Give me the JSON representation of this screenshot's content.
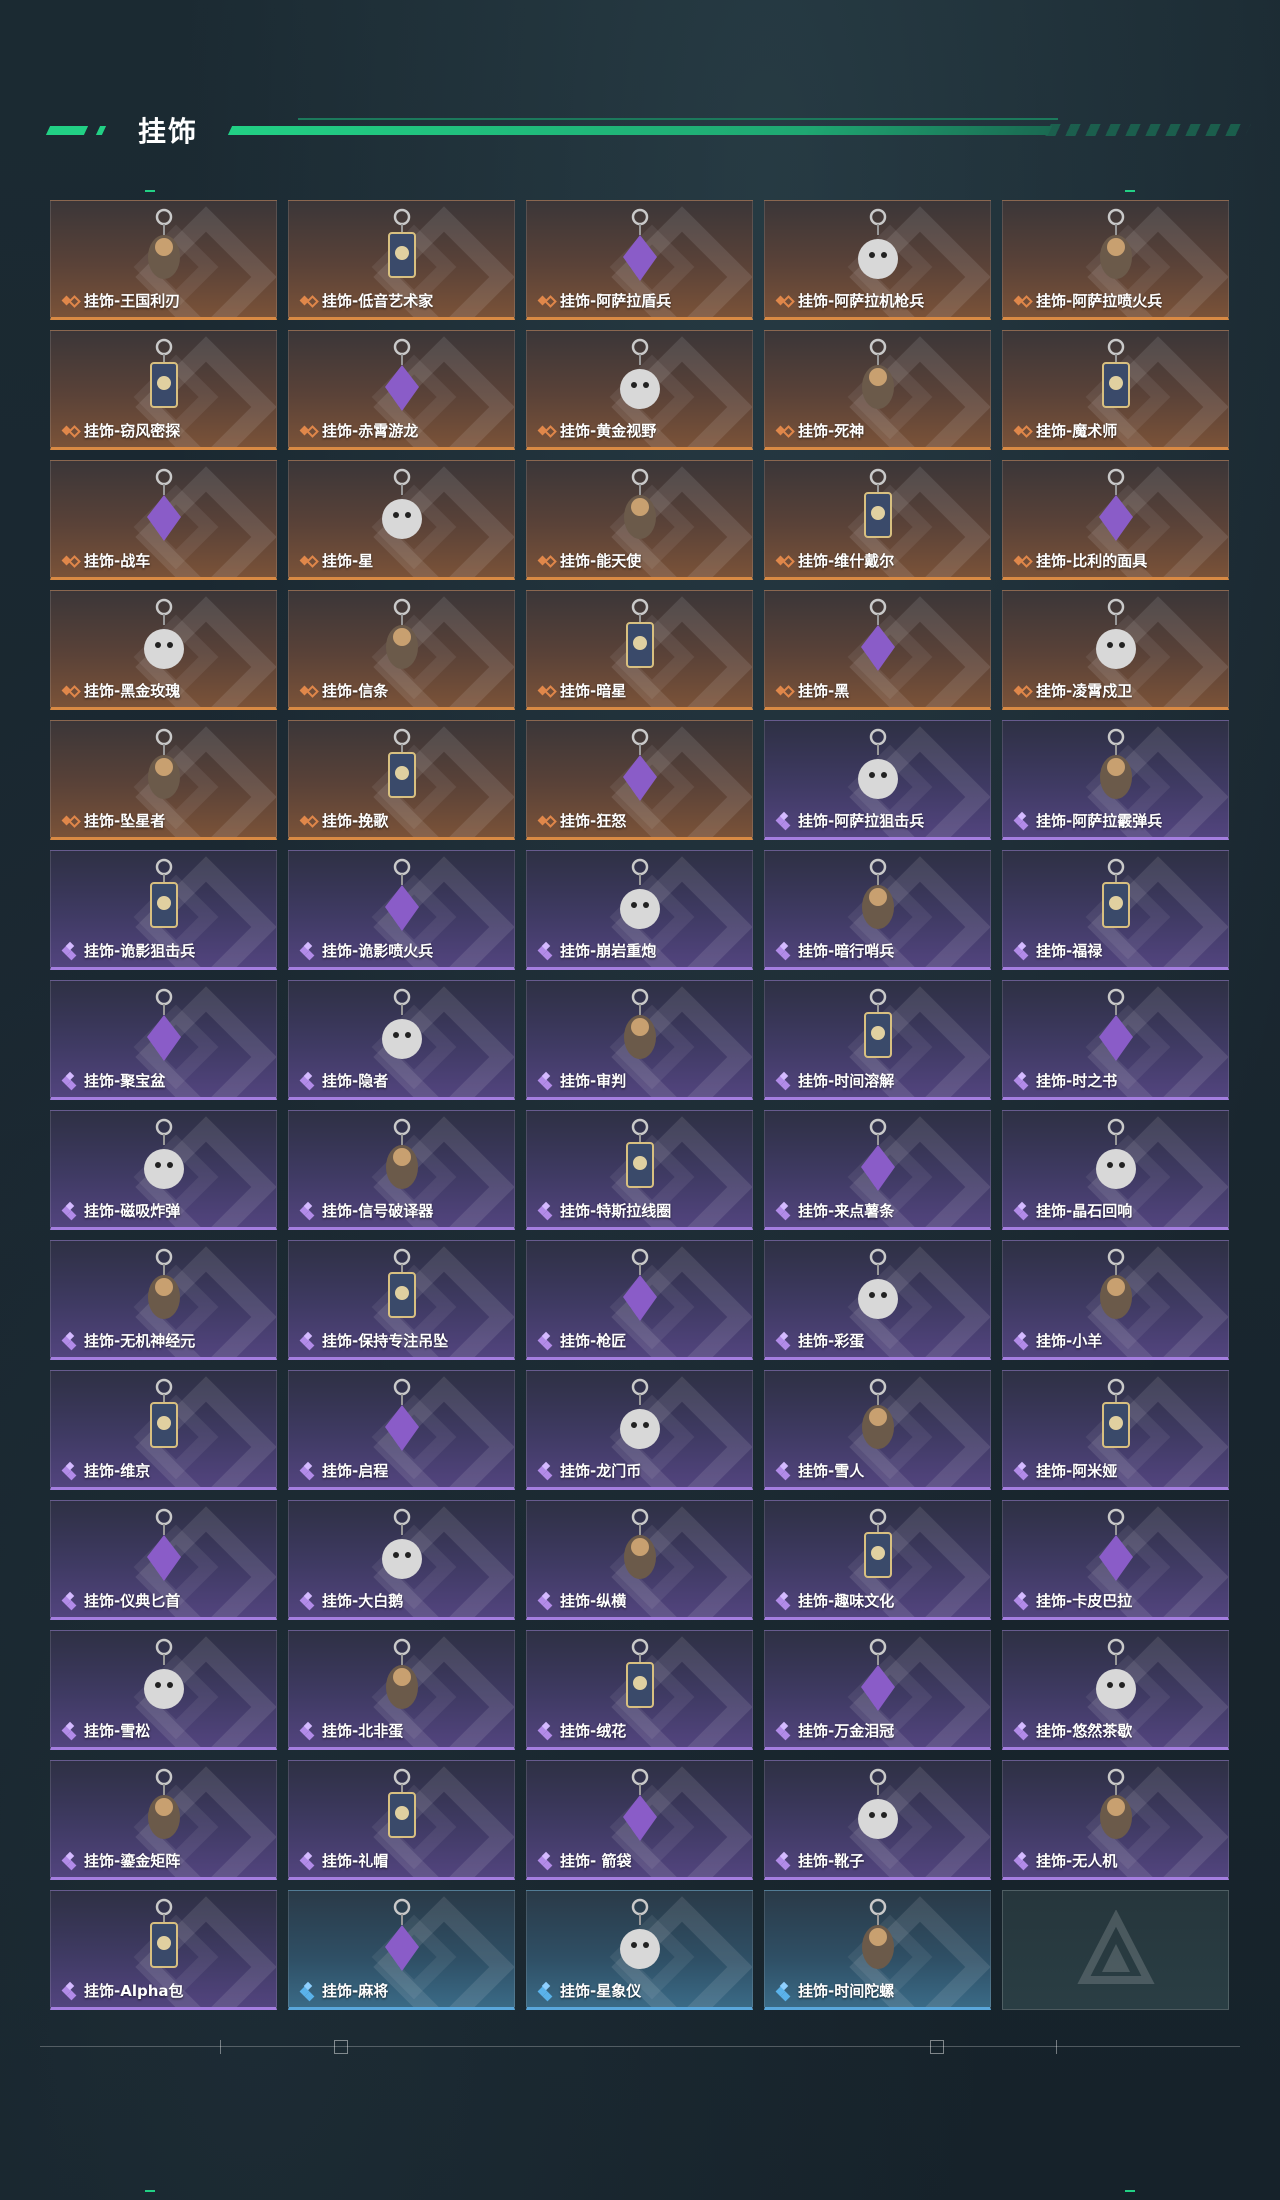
{
  "title": "挂饰",
  "items": [
    {
      "name": "挂饰-王国利刃",
      "rarity": "gold"
    },
    {
      "name": "挂饰-低音艺术家",
      "rarity": "gold"
    },
    {
      "name": "挂饰-阿萨拉盾兵",
      "rarity": "gold"
    },
    {
      "name": "挂饰-阿萨拉机枪兵",
      "rarity": "gold"
    },
    {
      "name": "挂饰-阿萨拉喷火兵",
      "rarity": "gold"
    },
    {
      "name": "挂饰-窃风密探",
      "rarity": "gold"
    },
    {
      "name": "挂饰-赤霄游龙",
      "rarity": "gold"
    },
    {
      "name": "挂饰-黄金视野",
      "rarity": "gold"
    },
    {
      "name": "挂饰-死神",
      "rarity": "gold"
    },
    {
      "name": "挂饰-魔术师",
      "rarity": "gold"
    },
    {
      "name": "挂饰-战车",
      "rarity": "gold"
    },
    {
      "name": "挂饰-星",
      "rarity": "gold"
    },
    {
      "name": "挂饰-能天使",
      "rarity": "gold"
    },
    {
      "name": "挂饰-维什戴尔",
      "rarity": "gold"
    },
    {
      "name": "挂饰-比利的面具",
      "rarity": "gold"
    },
    {
      "name": "挂饰-黑金玫瑰",
      "rarity": "gold"
    },
    {
      "name": "挂饰-信条",
      "rarity": "gold"
    },
    {
      "name": "挂饰-暗星",
      "rarity": "gold"
    },
    {
      "name": "挂饰-黑",
      "rarity": "gold"
    },
    {
      "name": "挂饰-凌霄戍卫",
      "rarity": "gold"
    },
    {
      "name": "挂饰-坠星者",
      "rarity": "gold"
    },
    {
      "name": "挂饰-挽歌",
      "rarity": "gold"
    },
    {
      "name": "挂饰-狂怒",
      "rarity": "gold"
    },
    {
      "name": "挂饰-阿萨拉狙击兵",
      "rarity": "purple"
    },
    {
      "name": "挂饰-阿萨拉霰弹兵",
      "rarity": "purple"
    },
    {
      "name": "挂饰-诡影狙击兵",
      "rarity": "purple"
    },
    {
      "name": "挂饰-诡影喷火兵",
      "rarity": "purple"
    },
    {
      "name": "挂饰-崩岩重炮",
      "rarity": "purple"
    },
    {
      "name": "挂饰-暗行哨兵",
      "rarity": "purple"
    },
    {
      "name": "挂饰-福禄",
      "rarity": "purple"
    },
    {
      "name": "挂饰-聚宝盆",
      "rarity": "purple"
    },
    {
      "name": "挂饰-隐者",
      "rarity": "purple"
    },
    {
      "name": "挂饰-审判",
      "rarity": "purple"
    },
    {
      "name": "挂饰-时间溶解",
      "rarity": "purple"
    },
    {
      "name": "挂饰-时之书",
      "rarity": "purple"
    },
    {
      "name": "挂饰-磁吸炸弹",
      "rarity": "purple"
    },
    {
      "name": "挂饰-信号破译器",
      "rarity": "purple"
    },
    {
      "name": "挂饰-特斯拉线圈",
      "rarity": "purple"
    },
    {
      "name": "挂饰-来点薯条",
      "rarity": "purple"
    },
    {
      "name": "挂饰-晶石回响",
      "rarity": "purple"
    },
    {
      "name": "挂饰-无机神经元",
      "rarity": "purple"
    },
    {
      "name": "挂饰-保持专注吊坠",
      "rarity": "purple"
    },
    {
      "name": "挂饰-枪匠",
      "rarity": "purple"
    },
    {
      "name": "挂饰-彩蛋",
      "rarity": "purple"
    },
    {
      "name": "挂饰-小羊",
      "rarity": "purple"
    },
    {
      "name": "挂饰-维京",
      "rarity": "purple"
    },
    {
      "name": "挂饰-启程",
      "rarity": "purple"
    },
    {
      "name": "挂饰-龙门币",
      "rarity": "purple"
    },
    {
      "name": "挂饰-雪人",
      "rarity": "purple"
    },
    {
      "name": "挂饰-阿米娅",
      "rarity": "purple"
    },
    {
      "name": "挂饰-仪典匕首",
      "rarity": "purple"
    },
    {
      "name": "挂饰-大白鹅",
      "rarity": "purple"
    },
    {
      "name": "挂饰-纵横",
      "rarity": "purple"
    },
    {
      "name": "挂饰-趣味文化",
      "rarity": "purple"
    },
    {
      "name": "挂饰-卡皮巴拉",
      "rarity": "purple"
    },
    {
      "name": "挂饰-雪松",
      "rarity": "purple"
    },
    {
      "name": "挂饰-北非蛋",
      "rarity": "purple"
    },
    {
      "name": "挂饰-绒花",
      "rarity": "purple"
    },
    {
      "name": "挂饰-万金泪冠",
      "rarity": "purple"
    },
    {
      "name": "挂饰-悠然茶歇",
      "rarity": "purple"
    },
    {
      "name": "挂饰-鎏金矩阵",
      "rarity": "purple"
    },
    {
      "name": "挂饰-礼帽",
      "rarity": "purple"
    },
    {
      "name": "挂饰- 箭袋",
      "rarity": "purple"
    },
    {
      "name": "挂饰-靴子",
      "rarity": "purple"
    },
    {
      "name": "挂饰-无人机",
      "rarity": "purple"
    },
    {
      "name": "挂饰-Alpha包",
      "rarity": "purple"
    },
    {
      "name": "挂饰-麻将",
      "rarity": "blue"
    },
    {
      "name": "挂饰-星象仪",
      "rarity": "blue"
    },
    {
      "name": "挂饰-时间陀螺",
      "rarity": "blue"
    },
    {
      "name": "",
      "rarity": "empty"
    }
  ],
  "colors": {
    "accent": "#22d085",
    "gold_border": "#d98a44",
    "purple_border": "#a57ee0",
    "blue_border": "#5aa7dc"
  },
  "icons": {
    "rarity": "rarity-diamond-icon",
    "item": "charm-pendant-icon",
    "empty": "delta-logo-icon"
  }
}
